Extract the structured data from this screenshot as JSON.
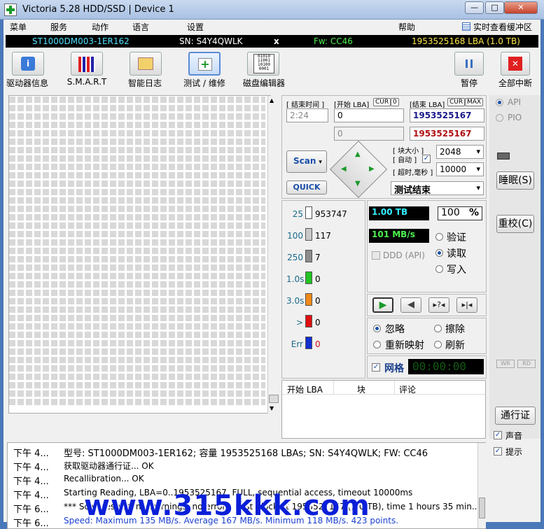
{
  "window": {
    "title": "Victoria 5.28 HDD/SSD | Device 1",
    "min": "—",
    "max": "□",
    "close": "✕"
  },
  "menu": [
    "菜单",
    "服务",
    "动作",
    "语言",
    "设置",
    "帮助"
  ],
  "menu_right": "实时查看缓冲区",
  "device": {
    "model": "ST1000DM003-1ER162",
    "sn": "SN: S4Y4QWLK",
    "x": "x",
    "fw": "Fw: CC46",
    "lba": "1953525168 LBA (1.0 TB)"
  },
  "toolbar": {
    "drive_info": "驱动器信息",
    "smart": "S.M.A.R.T",
    "smart_log": "智能日志",
    "test": "测试 / 维修",
    "editor": "磁盘编辑器",
    "pause": "暂停",
    "abort": "全部中断"
  },
  "scan": {
    "end_time_label": "[ 结束时间 ]",
    "start_lba_label": "[开始 LBA]",
    "cur": "CUR",
    "zero": "0",
    "end_lba_label": "[结束 LBA]",
    "max": "MAX",
    "time": "2:24",
    "start_lba": "0",
    "end_lba": "1953525167",
    "start_lba2": "0",
    "end_lba2": "1953525167",
    "block_size_label": "[ 块大小 ]",
    "auto_label": "[ 自动 ]",
    "timeout_label": "[ 超时,毫秒 ]",
    "block_size": "2048",
    "timeout": "10000",
    "scan_btn": "Scan",
    "quick_btn": "QUICK",
    "status": "测试结束"
  },
  "stats": [
    {
      "label": "25",
      "count": "953747",
      "color": "#ffffff"
    },
    {
      "label": "100",
      "count": "117",
      "color": "#c8c8c8"
    },
    {
      "label": "250",
      "count": "7",
      "color": "#8c8c8c"
    },
    {
      "label": "1.0s",
      "count": "0",
      "color": "#22c422"
    },
    {
      "label": "3.0s",
      "count": "0",
      "color": "#f08a1a"
    },
    {
      "label": ">",
      "count": "0",
      "color": "#e01010"
    },
    {
      "label": "Err",
      "count": "0",
      "color": "#1030d0"
    }
  ],
  "readout": {
    "size": "1.00 TB",
    "percent": "100",
    "pct_sign": "%",
    "speed": "101 MB/s",
    "ddd": "DDD (API)"
  },
  "mode": {
    "verify": "验证",
    "read": "读取",
    "write": "写入"
  },
  "action": {
    "ignore": "忽略",
    "erase": "擦除",
    "remap": "重新映射",
    "refresh": "刷新"
  },
  "grid_label": "网格",
  "timer": "00:00:00",
  "table_headers": [
    "开始 LBA",
    "块",
    "评论"
  ],
  "right": {
    "api": "API",
    "pio": "PIO",
    "sleep": "睡眠(S)",
    "recal": "重校(C)",
    "wr": "WR",
    "rd": "RD",
    "passport": "通行证"
  },
  "log": [
    {
      "t": "下午 4...",
      "m": "型号: ST1000DM003-1ER162; 容量 1953525168 LBAs; SN: S4Y4QWLK; FW: CC46",
      "c": "#000"
    },
    {
      "t": "下午 4...",
      "m": "获取驱动器通行证... OK",
      "c": "#000"
    },
    {
      "t": "下午 4...",
      "m": "Recallibration... OK",
      "c": "#000"
    },
    {
      "t": "下午 4...",
      "m": "Starting Reading, LBA=0..1953525167, FULL, sequential access, timeout 10000ms",
      "c": "#000"
    },
    {
      "t": "下午 6...",
      "m": "*** Scan results: no warnings, no errors. Last block at 1953525167 (1.0 TB), time 1 hours 35 min...",
      "c": "#000"
    },
    {
      "t": "下午 6...",
      "m": "Speed: Maximum 135 MB/s. Average 167 MB/s. Minimum 118 MB/s. 423 points.",
      "c": "#1a3fd0"
    }
  ],
  "log_opts": {
    "sound": "声音",
    "hints": "提示"
  },
  "watermark": "www.315kkk.com"
}
